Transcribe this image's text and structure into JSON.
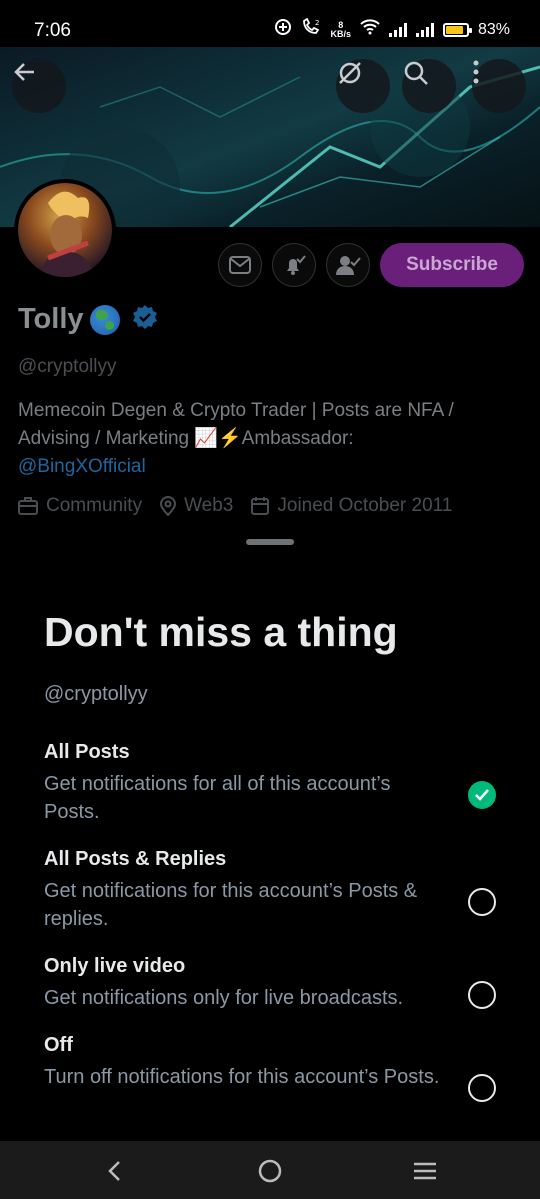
{
  "status_bar": {
    "time": "7:06",
    "net_speed_value": "8",
    "net_speed_unit": "KB/s",
    "battery_percent": "83%",
    "battery_level": 0.83,
    "icons": [
      "data-saver-icon",
      "wifi-calling-icon",
      "wifi-icon",
      "signal-icon",
      "signal-icon",
      "battery-icon"
    ]
  },
  "profile": {
    "header_icons": [
      "back-arrow-icon",
      "grok-icon",
      "search-icon",
      "more-vertical-icon"
    ],
    "action_icons": [
      "message-icon",
      "notification-bell-icon",
      "following-icon"
    ],
    "subscribe_label": "Subscribe",
    "name": "Tolly",
    "handle": "@cryptollyy",
    "bio_text": "Memecoin Degen & Crypto Trader | Posts are NFA  / Advising / Marketing  📈⚡Ambassador:",
    "bio_link": "@BingXOfficial",
    "meta": {
      "category": "Community",
      "location": "Web3",
      "joined": "Joined October 2011"
    }
  },
  "sheet": {
    "title": "Don't miss a thing",
    "handle": "@cryptollyy",
    "options": [
      {
        "title": "All Posts",
        "description": "Get notifications for all of this account’s Posts.",
        "selected": true
      },
      {
        "title": "All Posts & Replies",
        "description": "Get notifications for this account’s Posts & replies.",
        "selected": false
      },
      {
        "title": "Only live video",
        "description": "Get notifications only for live broadcasts.",
        "selected": false
      },
      {
        "title": "Off",
        "description": "Turn off notifications for this account’s Posts.",
        "selected": false
      }
    ]
  },
  "nav_bar": {
    "icons": [
      "back-nav-icon",
      "home-nav-icon",
      "recents-nav-icon"
    ]
  },
  "colors": {
    "accent_selected": "#00ba7c",
    "subscribe_bg": "#6a1f7a",
    "link": "#1d9bf0"
  }
}
